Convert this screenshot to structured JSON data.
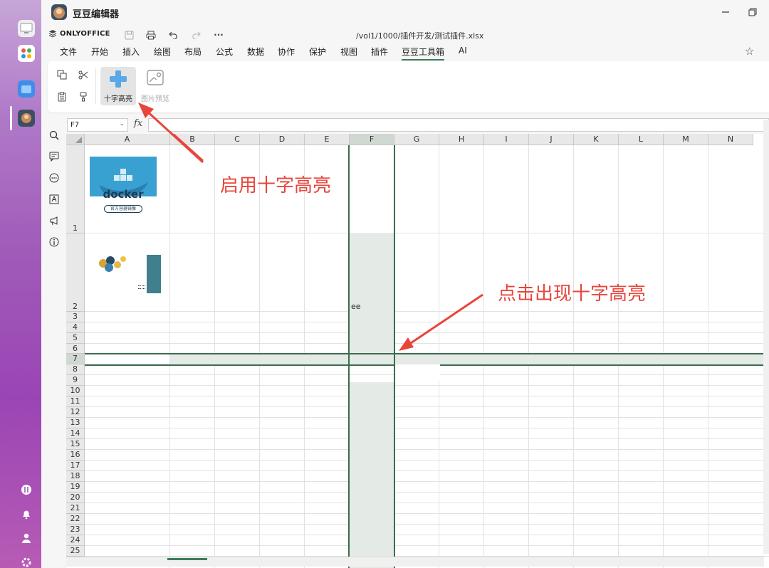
{
  "app": {
    "title": "豆豆编辑器"
  },
  "header": {
    "logo_text": "ONLYOFFICE",
    "file_path": "/vol1/1000/插件开发/测试插件.xlsx",
    "more": "···"
  },
  "menu": {
    "items": [
      "文件",
      "开始",
      "插入",
      "绘图",
      "布局",
      "公式",
      "数据",
      "协作",
      "保护",
      "视图",
      "插件",
      "豆豆工具箱",
      "AI"
    ],
    "active": "豆豆工具箱"
  },
  "ribbon": {
    "cross_highlight_label": "十字高亮",
    "image_preview_label": "图片预览"
  },
  "formula_bar": {
    "name_box": "F7",
    "fx_label": "fx",
    "dropdown_glyph": "⌄"
  },
  "sheet": {
    "columns": [
      "A",
      "B",
      "C",
      "D",
      "E",
      "F",
      "G",
      "H",
      "I",
      "J",
      "K",
      "L",
      "M",
      "N"
    ],
    "rows": [
      "1",
      "2",
      "3",
      "4",
      "5",
      "6",
      "7",
      "8",
      "9",
      "10",
      "11",
      "12",
      "13",
      "14",
      "15",
      "16",
      "17",
      "18",
      "19",
      "20",
      "21",
      "22",
      "23",
      "24",
      "25"
    ],
    "selected_cell": "F7",
    "cell_f2": "ee",
    "docker_logo_text": "docker",
    "docker_subtitle": "官方容器镜像"
  },
  "annotations": {
    "enable_text": "启用十字高亮",
    "click_text": "点击出现十字高亮"
  },
  "colors": {
    "highlight_fill": "#e4ebe6",
    "highlight_border": "#3d6b4e",
    "annotation": "#e8453c",
    "active_tab_underline": "#3b7c58"
  }
}
